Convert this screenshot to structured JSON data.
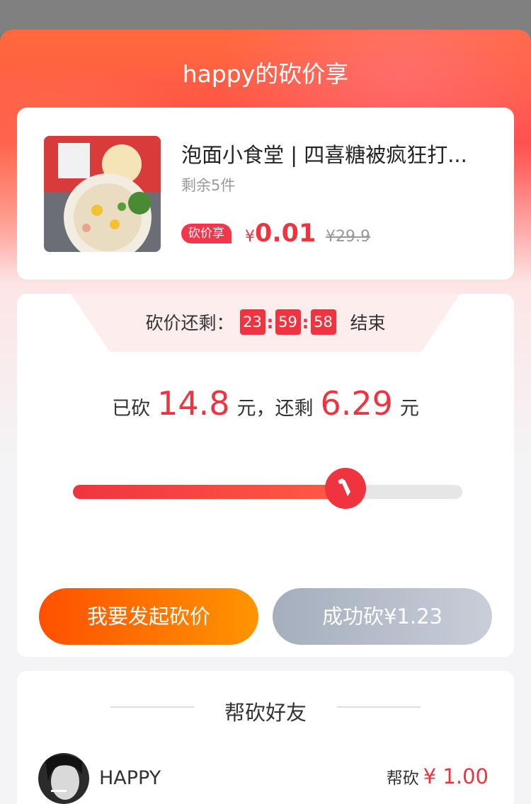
{
  "header": {
    "title": "happy的砍价享"
  },
  "product": {
    "name": "泡面小食堂 | 四喜糖被疯狂打...",
    "stock": "剩余5件",
    "tag": "砍价享",
    "currency": "¥",
    "price": "0.01",
    "original_price": "¥29.9"
  },
  "countdown": {
    "label": "砍价还剩：",
    "hours": "23",
    "minutes": "59",
    "seconds": "58",
    "suffix": "结束"
  },
  "summary": {
    "prefix": "已砍",
    "cut_amount": "14.8",
    "unit": "元",
    "middle": "，还剩",
    "remaining_amount": "6.29"
  },
  "progress": {
    "fraction": 0.7
  },
  "buttons": {
    "start_label": "我要发起砍价",
    "done_label": "成功砍¥1.23"
  },
  "friends": {
    "title": "帮砍好友",
    "items": [
      {
        "name": "HAPPY",
        "action": "帮砍",
        "amount": "¥ 1.00"
      }
    ]
  },
  "colors": {
    "accent": "#f0343f",
    "start_gradient": [
      "#ff5000",
      "#ff9500"
    ]
  },
  "icons": {
    "knob": "knife-icon"
  }
}
